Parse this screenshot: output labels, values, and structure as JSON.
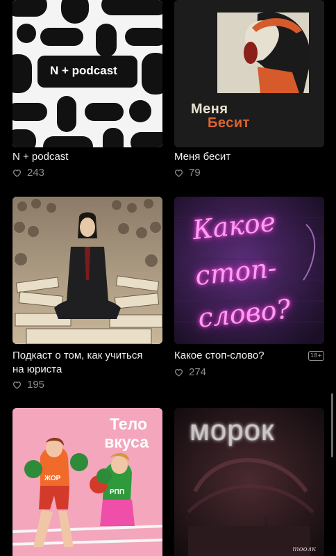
{
  "podcasts": [
    {
      "title": "N + podcast",
      "likes": "243",
      "cover_text": "N + podcast",
      "cover_accent": "#e5462f"
    },
    {
      "title": "Меня бесит",
      "likes": "79",
      "cover_text_line1": "Меня",
      "cover_text_line2": "Бесит",
      "cover_accent": "#e0632e"
    },
    {
      "title": "Подкаст о том, как учиться на юриста",
      "likes": "195"
    },
    {
      "title": "Какое стоп-слово?",
      "likes": "274",
      "badge": "18+",
      "cover_lines": [
        "Какое",
        "стоп-",
        "слово?"
      ],
      "neon_color": "#ff7bf0"
    },
    {
      "title": "",
      "likes": "",
      "cover_line1": "Тело",
      "cover_line2": "вкуса",
      "shirt_left": "ЖОР",
      "shirt_right": "РПП"
    },
    {
      "title": "",
      "likes": "",
      "cover_text": "морок",
      "watermark": "тоолк"
    }
  ]
}
